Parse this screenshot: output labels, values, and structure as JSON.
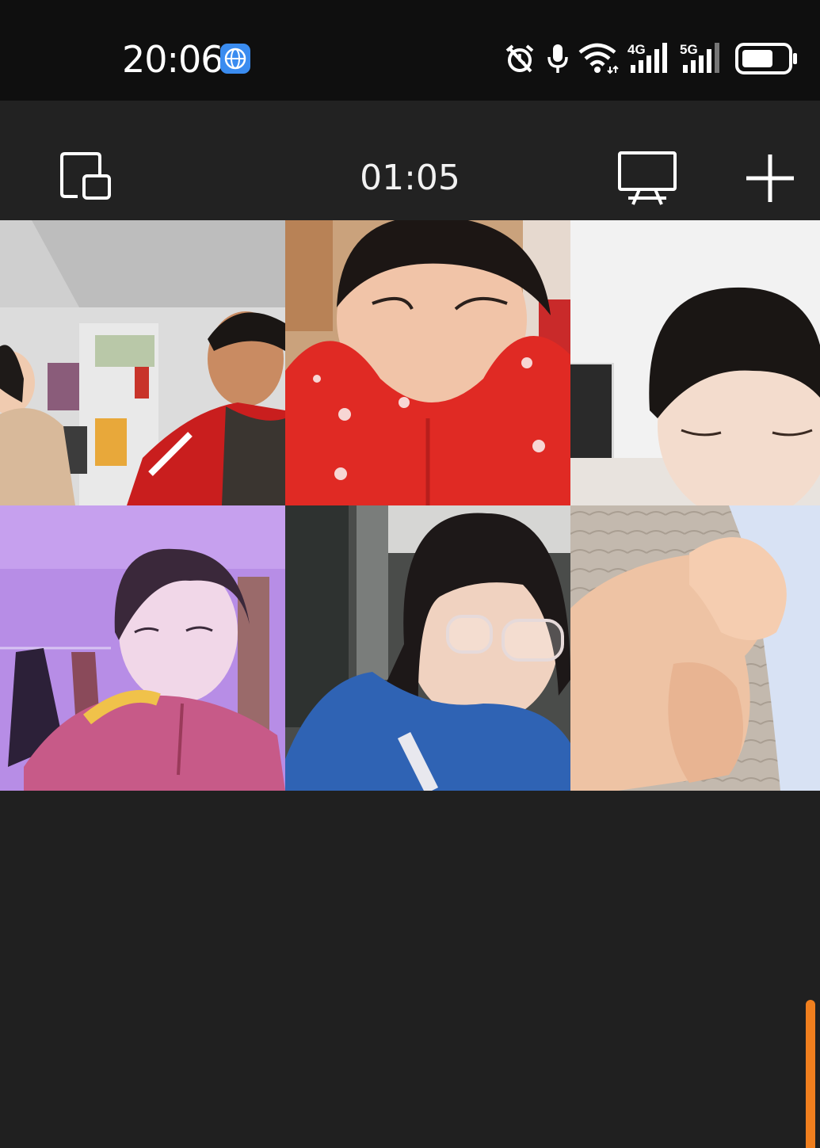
{
  "status_bar": {
    "time": "20:06",
    "icons": [
      "app-globe-icon",
      "alarm-icon",
      "microphone-icon",
      "wifi-icon",
      "signal-4g-icon",
      "signal-5g-icon",
      "battery-icon"
    ],
    "network_labels": {
      "first": "4G",
      "second": "5G"
    }
  },
  "toolbar": {
    "call_duration": "01:05",
    "buttons": [
      "switch-layout-icon",
      "screen-share-icon",
      "add-participant-icon"
    ]
  },
  "participants": [
    {
      "id": "p1",
      "scene": "two children in a room"
    },
    {
      "id": "p2",
      "scene": "child in red snowflake top"
    },
    {
      "id": "p3",
      "scene": "child with bangs"
    },
    {
      "id": "p4",
      "scene": "girl with purple lighting"
    },
    {
      "id": "p5",
      "scene": "girl with glasses writing"
    },
    {
      "id": "p6",
      "scene": "holding hands"
    }
  ],
  "colors": {
    "status_bg": "#0f0f0f",
    "toolbar_bg": "#222222",
    "page_bg": "#202020",
    "scroll_accent": "#f07f1e"
  }
}
